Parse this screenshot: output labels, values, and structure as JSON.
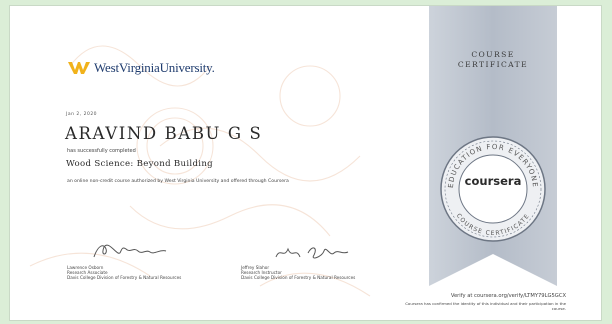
{
  "certificate": {
    "university": "WestVirginiaUniversity.",
    "date": "Jan 2, 2020",
    "recipient_name": "ARAVIND BABU G S",
    "completed_text": "has successfully completed",
    "course_title": "Wood Science: Beyond Building",
    "description": "an online non-credit course authorized by West Virginia University and offered through Coursera",
    "ribbon_title_line1": "COURSE",
    "ribbon_title_line2": "CERTIFICATE",
    "seal_word": "coursera",
    "seal_ring_text": "EDUCATION FOR EVERYONE",
    "seal_ring_bottom": "COURSE CERTIFICATE",
    "verify_link": "Verify at coursera.org/verify/LTMY79LG5GCX",
    "verify_note": "Coursera has confirmed the identity of this individual and their participation in the course."
  },
  "signatories": [
    {
      "name": "Lawrence Osborn",
      "title": "Research Associate",
      "dept": "Davis College Division of Forestry & Natural Resources"
    },
    {
      "name": "Jeffrey Slahor",
      "title": "Research Instructor",
      "dept": "Davis College Division of Forestry & Natural Resources"
    }
  ],
  "colors": {
    "background": "#dbeed7",
    "ribbon": "#b4bcc8",
    "logo_gold": "#f1b21b",
    "logo_blue": "#1f3c6e"
  }
}
